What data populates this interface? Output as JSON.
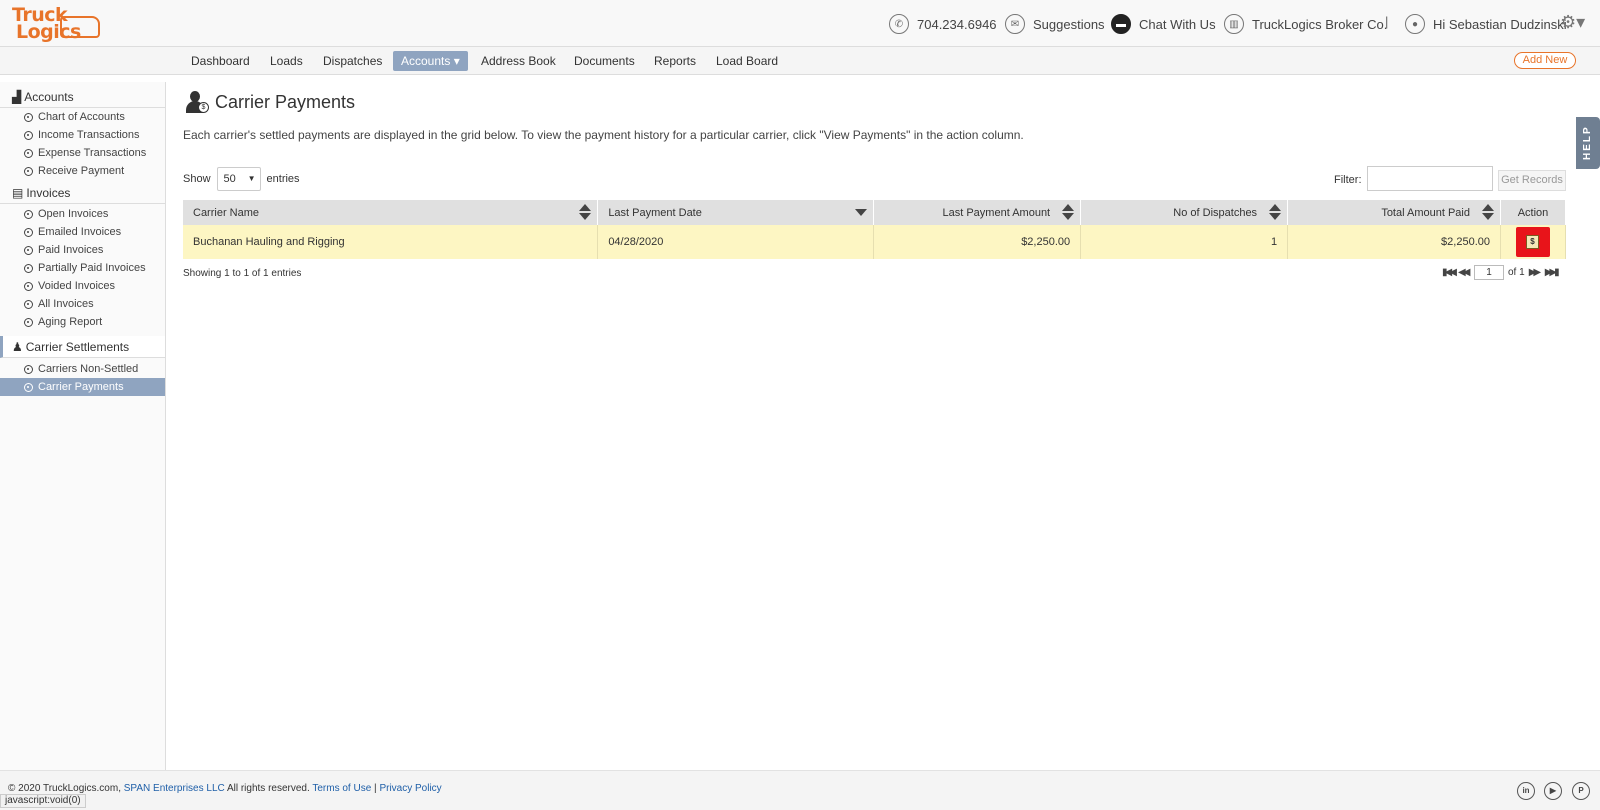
{
  "header": {
    "logo_line1": "Truck",
    "logo_line2": "Logics",
    "phone": "704.234.6946",
    "suggestions": "Suggestions",
    "chat": "Chat With Us",
    "company": "TruckLogics Broker Co.",
    "separator": "|",
    "greeting": "Hi Sebastian Dudzinski"
  },
  "nav": {
    "items": [
      "Dashboard",
      "Loads",
      "Dispatches",
      "Accounts",
      "Address Book",
      "Documents",
      "Reports",
      "Load Board"
    ],
    "active_caret": "▾",
    "add_new": "Add New"
  },
  "sidebar": {
    "accounts": {
      "label": "Accounts",
      "items": [
        "Chart of Accounts",
        "Income Transactions",
        "Expense Transactions",
        "Receive Payment"
      ]
    },
    "invoices": {
      "label": "Invoices",
      "items": [
        "Open Invoices",
        "Emailed Invoices",
        "Paid Invoices",
        "Partially Paid Invoices",
        "Voided Invoices",
        "All Invoices",
        "Aging Report"
      ]
    },
    "settlements": {
      "label": "Carrier Settlements",
      "items": [
        "Carriers Non-Settled",
        "Carrier Payments"
      ]
    }
  },
  "main": {
    "title": "Carrier Payments",
    "description": "Each carrier's settled payments are displayed in the grid below. To view the payment history for a particular carrier, click \"View Payments\" in the action column.",
    "show_label": "Show",
    "entries_value": "50",
    "entries_label": "entries",
    "filter_label": "Filter:",
    "get_records": "Get Records",
    "columns": [
      "Carrier Name",
      "Last Payment Date",
      "Last Payment Amount",
      "No of Dispatches",
      "Total Amount Paid",
      "Action"
    ],
    "rows": [
      {
        "carrier": "Buchanan Hauling and Rigging",
        "last_date": "04/28/2020",
        "last_amount": "$2,250.00",
        "dispatches": "1",
        "total": "$2,250.00"
      }
    ],
    "showing": "Showing 1 to 1 of 1 entries",
    "page_value": "1",
    "page_of": "of 1",
    "help": "HELP"
  },
  "footer": {
    "prefix": "© 2020 TruckLogics.com, ",
    "company_link": "SPAN Enterprises LLC",
    "rights": " All rights reserved. ",
    "terms": "Terms of Use",
    "divider": " | ",
    "privacy": "Privacy Policy",
    "status": "javascript:void(0)"
  },
  "colors": {
    "brand_orange": "#e8742a",
    "nav_active": "#8fa4c0",
    "row_highlight": "#fdf6c3",
    "action_red": "#e8141a"
  },
  "icons": [
    "phone-icon",
    "mail-icon",
    "chat-icon",
    "building-icon",
    "user-icon",
    "gear-icon",
    "view-payments-icon",
    "linkedin-icon",
    "youtube-icon",
    "pinterest-icon"
  ]
}
